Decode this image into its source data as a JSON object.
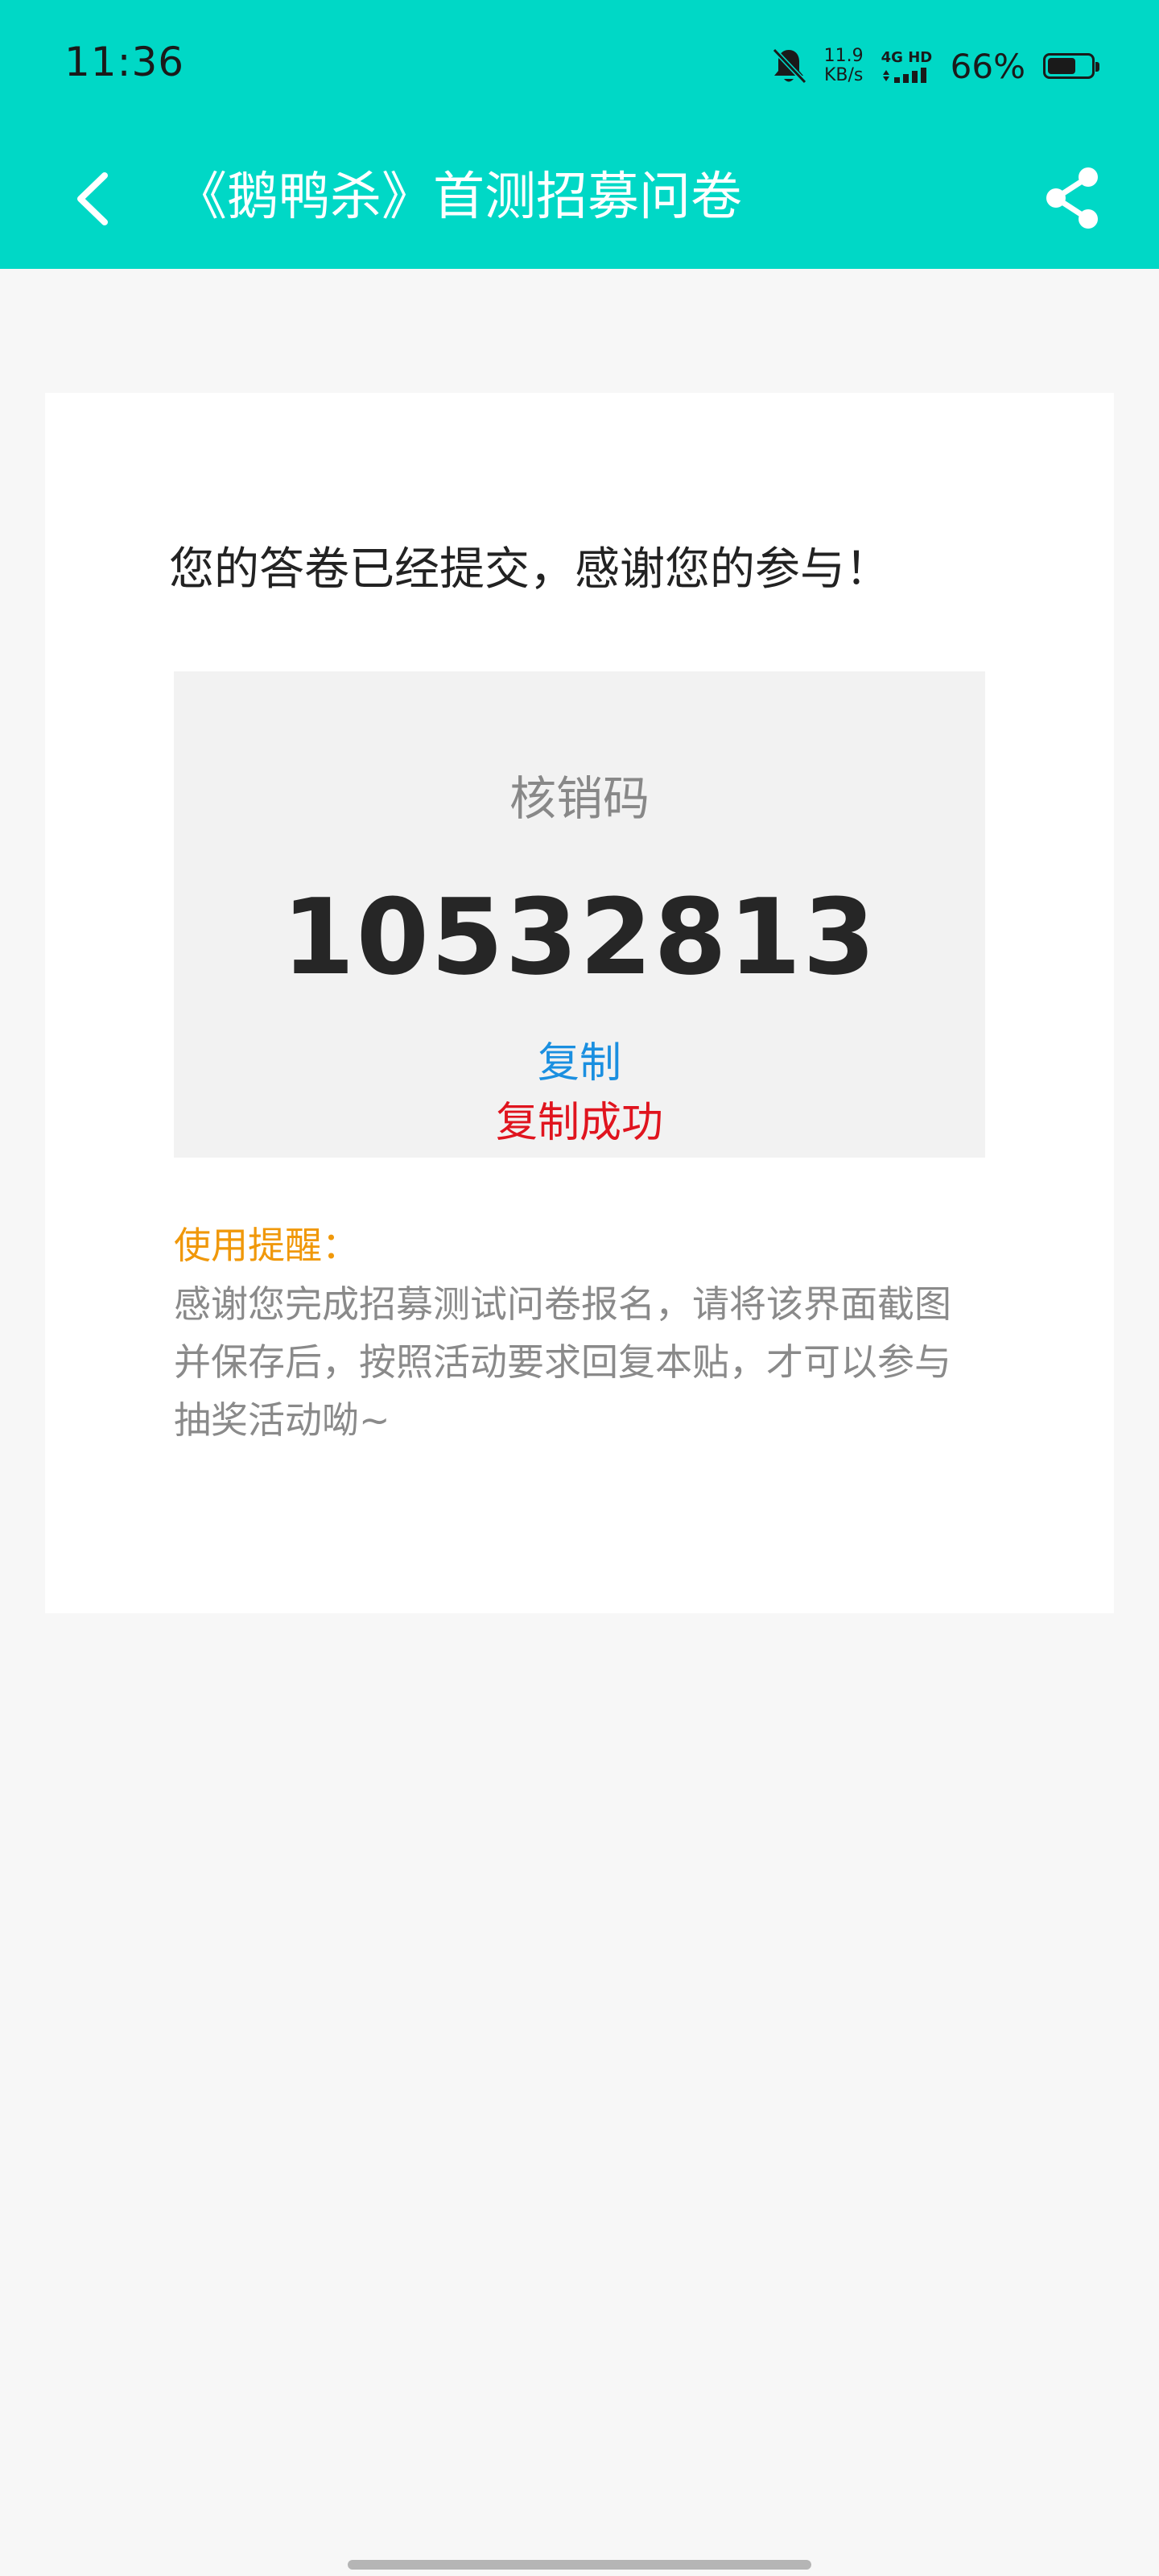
{
  "status_bar": {
    "time": "11:36",
    "net_speed_value": "11.9",
    "net_speed_unit": "KB/s",
    "net_type_top": "4G HD",
    "battery_percent": "66%",
    "battery_level": 0.66,
    "icons": [
      "mute-bell-icon",
      "signal-icon",
      "battery-icon"
    ]
  },
  "header": {
    "title": "《鹅鸭杀》首测招募问卷",
    "back_icon": "chevron-left-icon",
    "share_icon": "share-icon",
    "background_color": "#00d8c6"
  },
  "card": {
    "success_message": "您的答卷已经提交，感谢您的参与！",
    "code_label": "核销码",
    "code_value": "10532813",
    "copy_label": "复制",
    "copy_success": "复制成功",
    "tip_title": "使用提醒：",
    "tip_text": "感谢您完成招募测试问卷报名，请将该界面截图并保存后，按照活动要求回复本贴，才可以参与抽奖活动呦~"
  },
  "colors": {
    "accent": "#00d8c6",
    "link": "#1a8fe0",
    "success": "#e0141e",
    "tip_title": "#f0980a"
  }
}
